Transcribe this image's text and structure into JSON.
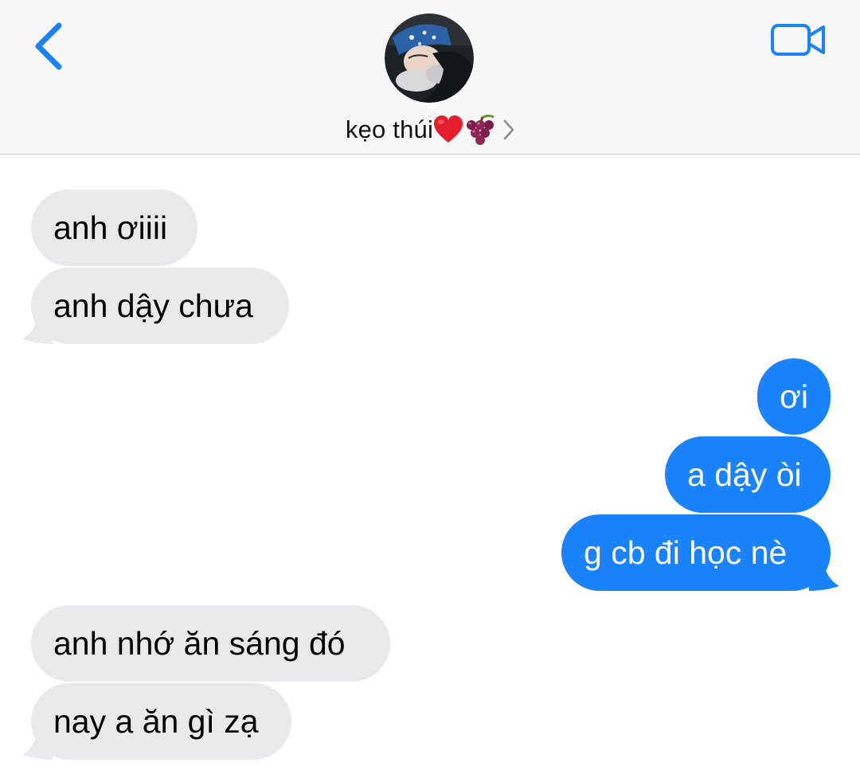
{
  "colors": {
    "accent": "#1a82fb",
    "incoming_bubble": "#e9e9eb",
    "outgoing_bubble": "#1a82fb",
    "header_bg": "#f8f8f8"
  },
  "header": {
    "back_icon": "chevron-left-icon",
    "video_icon": "video-camera-icon",
    "contact_name": "kẹo thúi",
    "contact_emojis": [
      "red-heart-emoji",
      "grapes-emoji"
    ],
    "disclosure_icon": "chevron-right-icon"
  },
  "messages": [
    {
      "direction": "incoming",
      "text": "anh ơiiii"
    },
    {
      "direction": "incoming",
      "text": "anh dậy chưa"
    },
    {
      "direction": "outgoing",
      "text": "ơi"
    },
    {
      "direction": "outgoing",
      "text": "a dậy òi"
    },
    {
      "direction": "outgoing",
      "text": "g cb đi học nè"
    },
    {
      "direction": "incoming",
      "text": "anh nhớ ăn sáng đó"
    },
    {
      "direction": "incoming",
      "text": "nay a ăn gì zạ"
    }
  ]
}
